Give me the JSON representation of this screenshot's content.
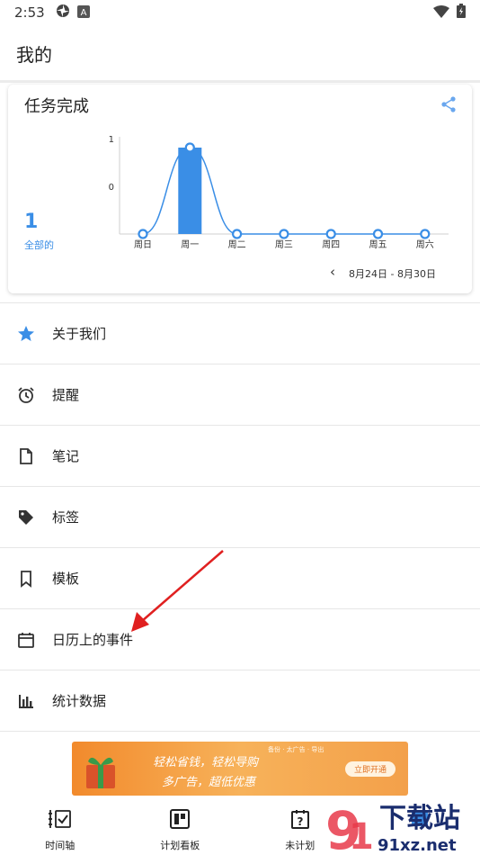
{
  "status": {
    "time": "2:53",
    "icons": [
      "settings-status-icon",
      "a-status-icon",
      "wifi-icon",
      "battery-icon"
    ]
  },
  "appbar": {
    "title": "我的"
  },
  "card": {
    "title": "任务完成",
    "total": "1",
    "total_label": "全部的",
    "date_range": "8月24日 - 8月30日"
  },
  "chart_data": {
    "type": "bar",
    "categories": [
      "周日",
      "周一",
      "周二",
      "周三",
      "周四",
      "周五",
      "周六"
    ],
    "values": [
      0,
      1,
      0,
      0,
      0,
      0,
      0
    ],
    "y_tick_labels": [
      "1",
      "0"
    ],
    "color": "#3a8ee6",
    "grid": false
  },
  "menu": {
    "items": [
      {
        "label": "关于我们",
        "icon": "star-icon"
      },
      {
        "label": "提醒",
        "icon": "alarm-icon"
      },
      {
        "label": "笔记",
        "icon": "note-icon"
      },
      {
        "label": "标签",
        "icon": "tag-icon"
      },
      {
        "label": "模板",
        "icon": "bookmark-icon"
      },
      {
        "label": "日历上的事件",
        "icon": "calendar-icon"
      },
      {
        "label": "统计数据",
        "icon": "bar-chart-icon"
      }
    ]
  },
  "ad": {
    "line1": "轻松省钱，轻松导购",
    "line2": "多广告，超低优惠",
    "top_text": "备份 · 太广告 · 导出",
    "button": "立即开通"
  },
  "bottomnav": {
    "items": [
      {
        "label": "时间轴",
        "icon": "timeline-icon"
      },
      {
        "label": "计划看板",
        "icon": "board-icon"
      },
      {
        "label": "未计划",
        "icon": "unplanned-icon"
      },
      {
        "label": "",
        "icon": "profile-icon"
      }
    ]
  },
  "watermark": {
    "text": "下载站",
    "domain": "91xz.net"
  },
  "colors": {
    "accent": "#3a8ee6",
    "arrow": "#e02020"
  }
}
